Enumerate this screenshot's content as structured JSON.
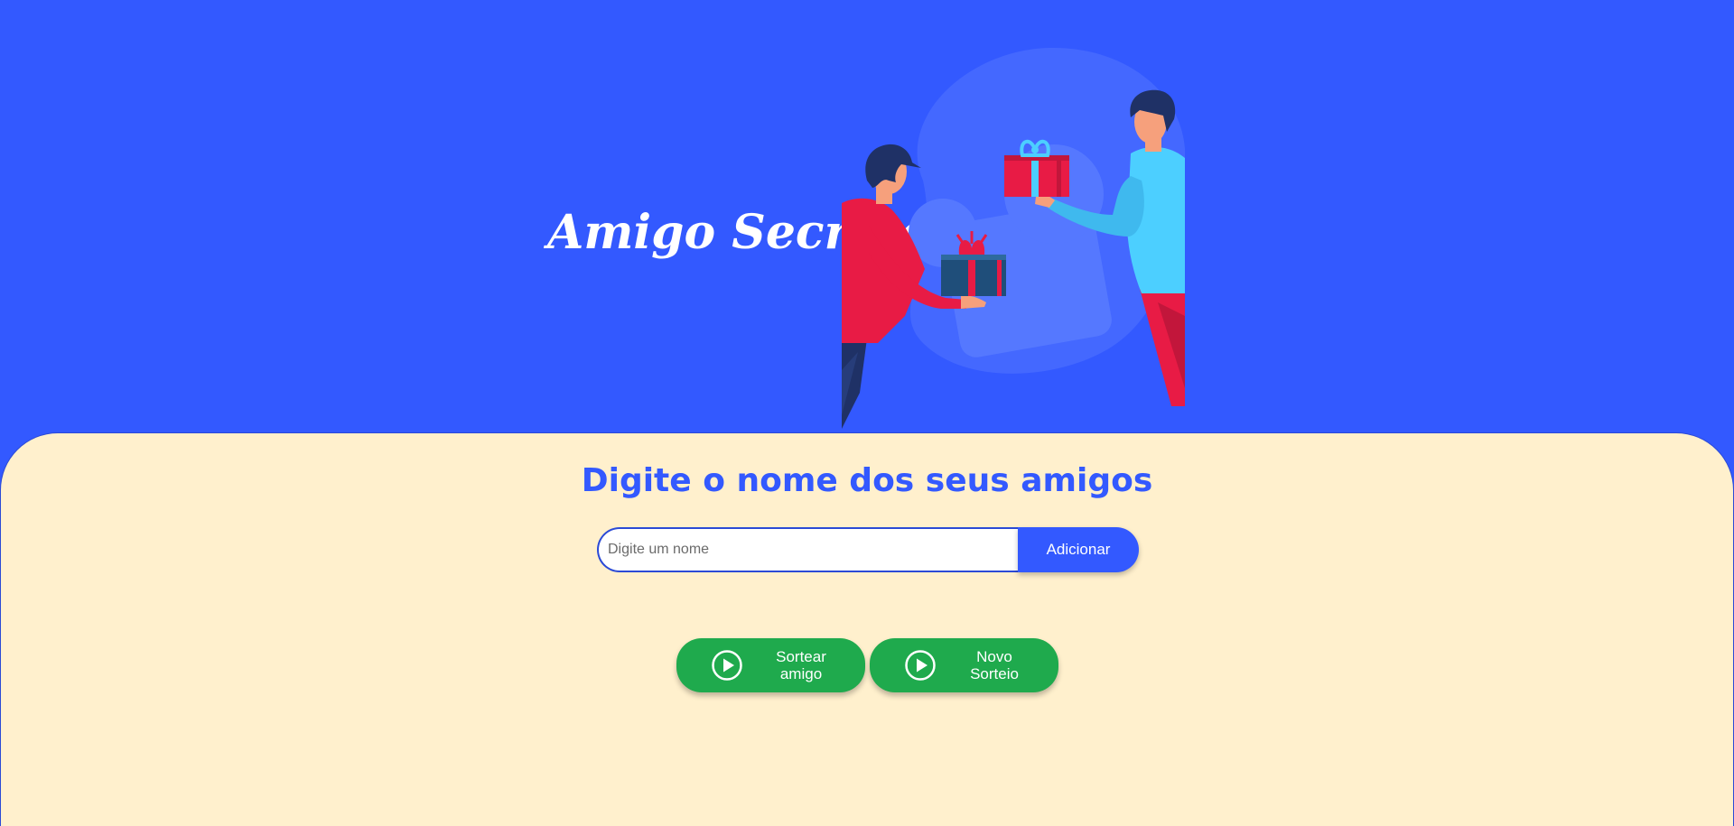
{
  "header": {
    "title": "Amigo Secreto",
    "illustration": "two-people-exchanging-gifts-image"
  },
  "main": {
    "subtitle": "Digite o nome dos seus amigos",
    "input": {
      "placeholder": "Digite um nome",
      "value": ""
    },
    "add_label": "Adicionar",
    "actions": [
      {
        "label": "Sortear\namigo",
        "icon": "play-circle-icon"
      },
      {
        "label": "Novo\nSorteio",
        "icon": "play-circle-icon"
      }
    ]
  },
  "colors": {
    "header_bg": "#3359FF",
    "main_bg": "#FFF0CD",
    "accent": "#3359FF",
    "action_bg": "#1FAA4D",
    "text_light": "#FFFFFF"
  }
}
